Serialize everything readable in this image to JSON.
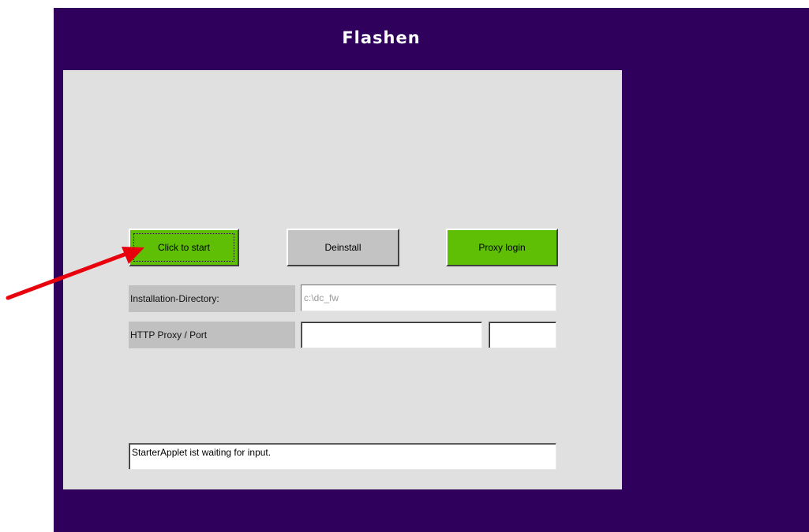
{
  "app": {
    "title": "Flashen"
  },
  "buttons": {
    "start_label": "Click to start",
    "deinstall_label": "Deinstall",
    "proxy_login_label": "Proxy login"
  },
  "fields": {
    "install_dir_label": "Installation-Directory:",
    "install_dir_value": "c:\\dc_fw",
    "proxy_label": "HTTP Proxy / Port",
    "proxy_host_value": "",
    "proxy_port_value": ""
  },
  "status": {
    "text": "StarterApplet ist waiting for input."
  },
  "colors": {
    "background": "#2f005c",
    "panel": "#e0e0e0",
    "button_green": "#5ebf05",
    "button_gray": "#c3c3c3",
    "arrow": "#e8000d"
  },
  "annotations": {
    "arrow_icon": "red-arrow-icon"
  }
}
